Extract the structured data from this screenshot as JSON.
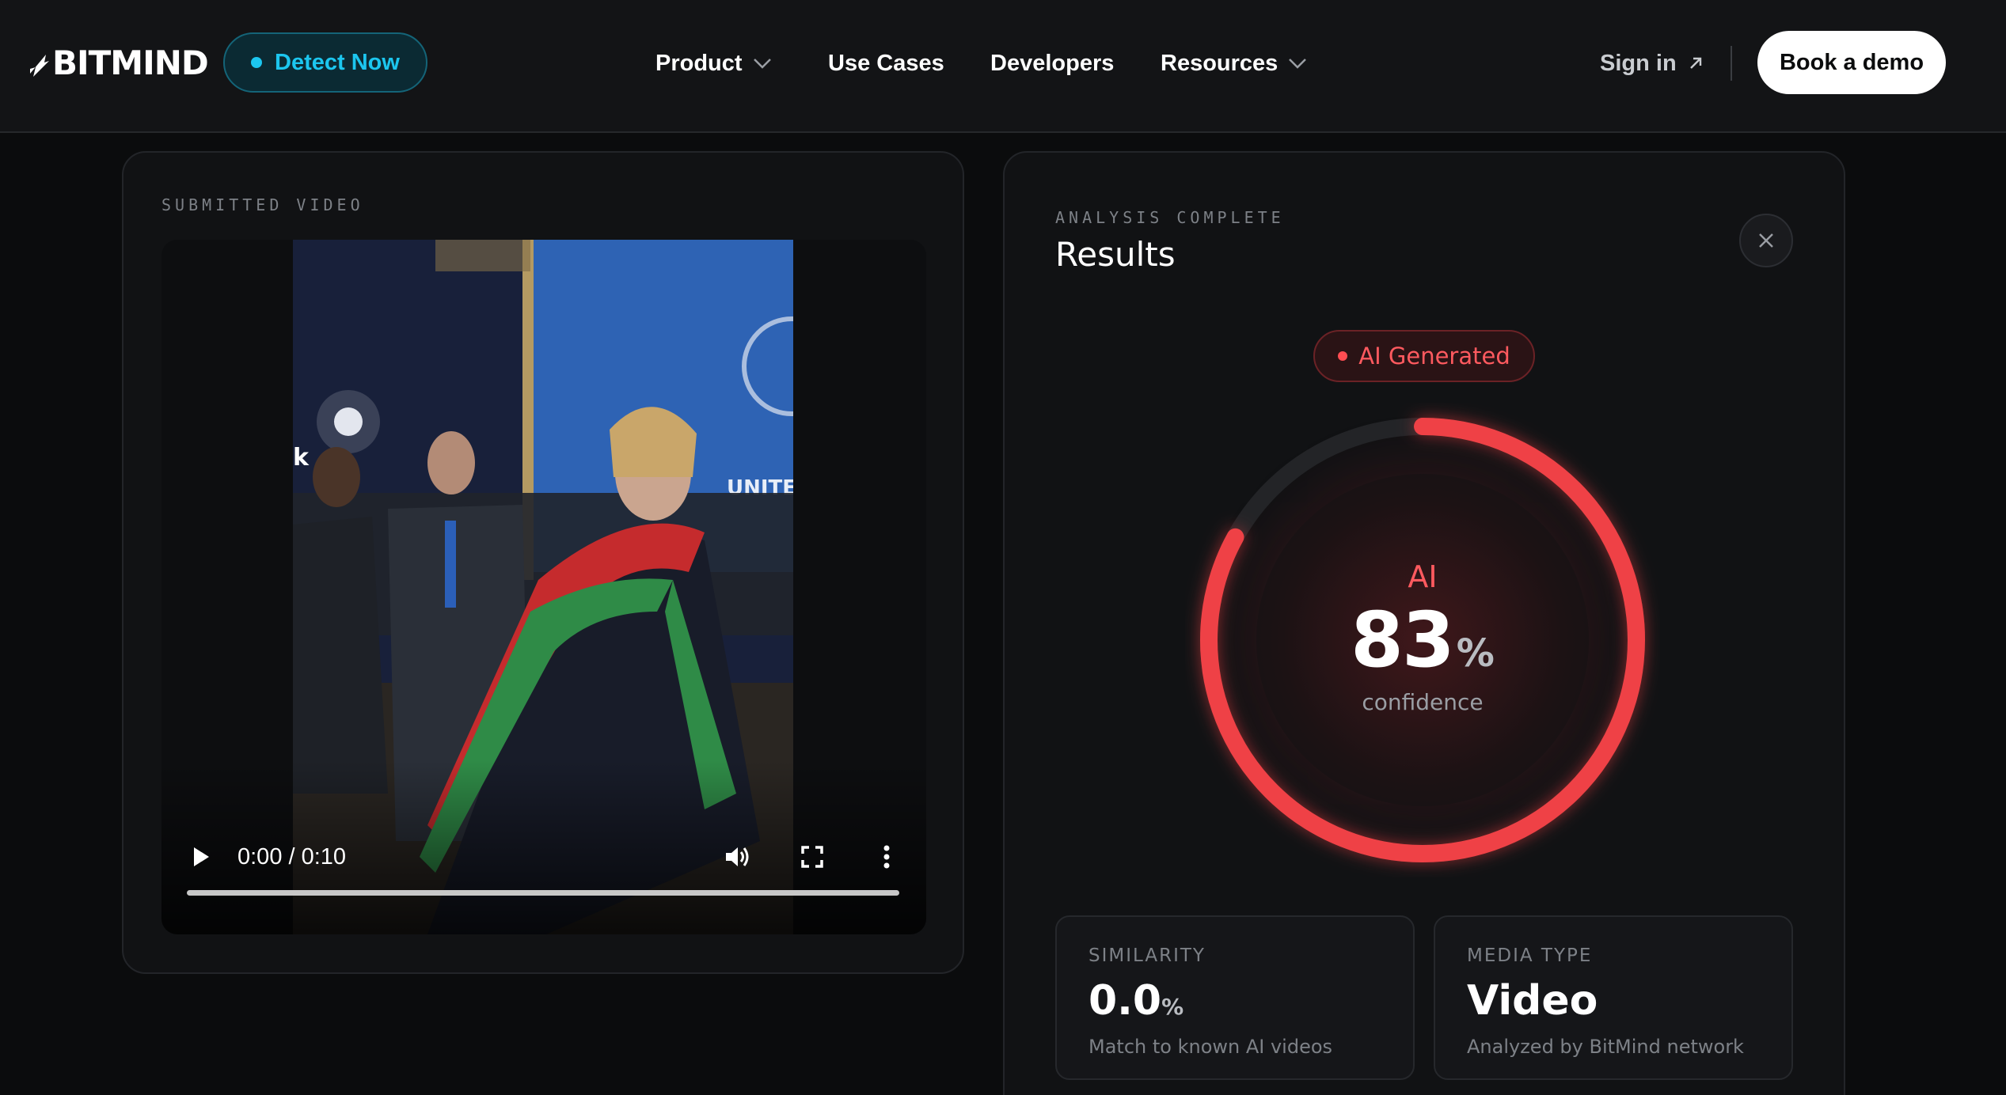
{
  "header": {
    "logo_text": "BITMIND",
    "detect_label": "Detect Now",
    "nav": [
      {
        "label": "Product",
        "has_menu": true
      },
      {
        "label": "Use Cases",
        "has_menu": false
      },
      {
        "label": "Developers",
        "has_menu": false
      },
      {
        "label": "Resources",
        "has_menu": true
      }
    ],
    "signin_label": "Sign in",
    "book_label": "Book a demo"
  },
  "submitted": {
    "eyebrow": "SUBMITTED VIDEO",
    "player": {
      "time": "0:00 / 0:10",
      "progress": 0.0,
      "controls": [
        "play-icon",
        "volume-icon",
        "fullscreen-icon",
        "more-options-icon"
      ]
    }
  },
  "results": {
    "eyebrow": "ANALYSIS COMPLETE",
    "title": "Results",
    "verdict": "AI Generated",
    "gauge": {
      "label": "AI",
      "value": "83",
      "unit": "%",
      "caption": "confidence",
      "fraction": 0.83
    },
    "stats": [
      {
        "label": "SIMILARITY",
        "value": "0.0",
        "unit": "%",
        "sub": "Match to known AI videos"
      },
      {
        "label": "MEDIA TYPE",
        "value": "Video",
        "unit": "",
        "sub": "Analyzed by BitMind network"
      }
    ]
  },
  "colors": {
    "accent_cyan": "#1cc6ef",
    "ai_red": "#ef4146",
    "background": "#0b0c0d"
  }
}
